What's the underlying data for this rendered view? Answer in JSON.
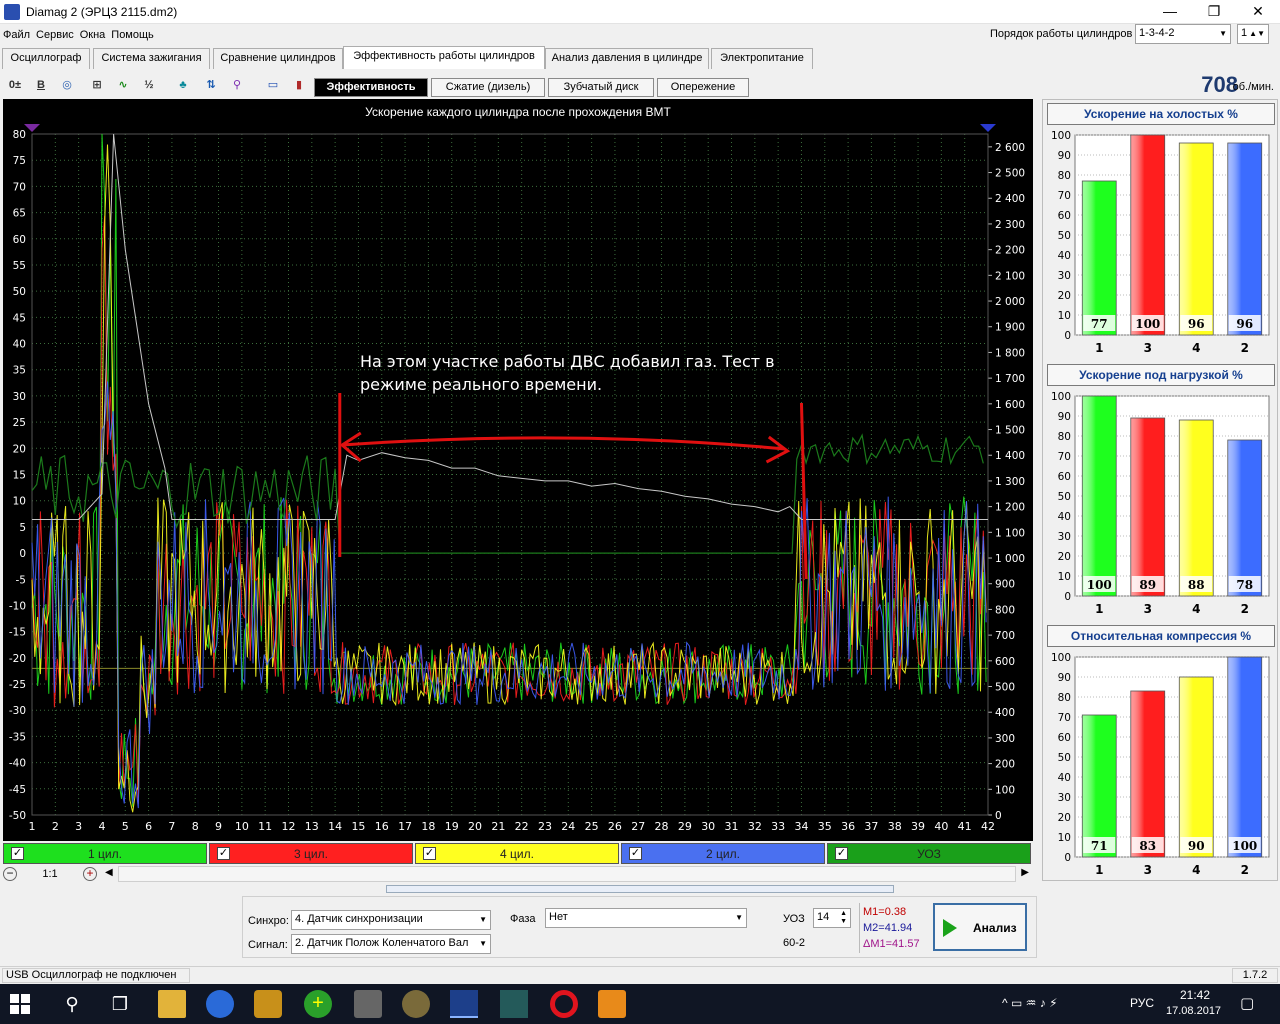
{
  "window": {
    "title": "Diamag 2 (ЭРЦЗ 2115.dm2)"
  },
  "menu": [
    "Файл",
    "Сервис",
    "Окна",
    "Помощь"
  ],
  "cylinder_order": {
    "label": "Порядок работы цилиндров",
    "value": "1-3-4-2",
    "second_value": "1"
  },
  "tabs": [
    "Осциллограф",
    "Система зажигания",
    "Сравнение цилиндров",
    "Эффективность работы цилиндров",
    "Анализ давления в цилиндре",
    "Электропитание"
  ],
  "active_tab": "Эффективность работы цилиндров",
  "toolbar": {
    "subtabs": [
      "Эффективность",
      "Сжатие (дизель)",
      "Зубчатый диск",
      "Опережение"
    ],
    "rpm": "708",
    "rpm_unit": "об./мин.",
    "b_label": "B"
  },
  "chart": {
    "title": "Ускорение каждого цилиндра после прохождения ВМТ",
    "annotation_line1": "На этом участке работы ДВС добавил газ. Тест в",
    "annotation_line2": "режиме реального времени.",
    "colors": {
      "background": "#000000",
      "grid": "#3c6e3c",
      "cyl1": "#1ee01e",
      "cyl3": "#ff2020",
      "cyl4": "#ffff20",
      "cyl2": "#4060ff",
      "uoz": "#1b7a1b",
      "rpm": "#c8c8c8",
      "annotation": "#e01010"
    }
  },
  "chart_data": {
    "type": "line",
    "title": "Ускорение каждого цилиндра после прохождения ВМТ",
    "x_ticks": [
      "1",
      "2",
      "3",
      "4",
      "5",
      "6",
      "7",
      "8",
      "9",
      "10",
      "11",
      "12",
      "13",
      "14",
      "15",
      "16",
      "17",
      "18",
      "19",
      "20",
      "21",
      "22",
      "23",
      "24",
      "25",
      "26",
      "27",
      "28",
      "29",
      "30",
      "31",
      "32",
      "33",
      "34",
      "35",
      "36",
      "37",
      "38",
      "39",
      "40",
      "41",
      "42"
    ],
    "y_left_ticks": [
      "80",
      "75",
      "70",
      "65",
      "60",
      "55",
      "50",
      "45",
      "40",
      "35",
      "30",
      "25",
      "20",
      "15",
      "10",
      "5",
      "0",
      "-5",
      "-10",
      "-15",
      "-20",
      "-25",
      "-30",
      "-35",
      "-40",
      "-45",
      "-50"
    ],
    "y_right_ticks": [
      "2 600",
      "2 500",
      "2 400",
      "2 300",
      "2 200",
      "2 100",
      "2 000",
      "1 900",
      "1 800",
      "1 700",
      "1 600",
      "1 500",
      "1 400",
      "1 300",
      "1 200",
      "1 100",
      "1 000",
      "900",
      "800",
      "700",
      "600",
      "500",
      "400",
      "300",
      "200",
      "100",
      "0"
    ],
    "ylim_left": [
      -50,
      80
    ],
    "ylim_right": [
      0,
      2650
    ],
    "xlim": [
      1,
      42
    ],
    "grid": true,
    "series": [
      {
        "name": "1 цил.",
        "color": "#1ee01e"
      },
      {
        "name": "3 цил.",
        "color": "#ff2020"
      },
      {
        "name": "4 цил.",
        "color": "#ffff20"
      },
      {
        "name": "2 цил.",
        "color": "#4060ff"
      },
      {
        "name": "УОЗ",
        "color": "#1b7a1b"
      }
    ],
    "rpm_trace": {
      "color": "#c8c8c8",
      "x": [
        1,
        3,
        4,
        4.5,
        5,
        6,
        6.7,
        7,
        13.5,
        14,
        14.5,
        15,
        16,
        17,
        18,
        19,
        20,
        21,
        22,
        23,
        24,
        25,
        26,
        27,
        28,
        29,
        30,
        31,
        32,
        33,
        33.5,
        34,
        35,
        42
      ],
      "y": [
        1150,
        1150,
        1250,
        2650,
        2200,
        1600,
        1350,
        1150,
        1150,
        1150,
        1400,
        1380,
        1410,
        1390,
        1380,
        1350,
        1350,
        1320,
        1310,
        1300,
        1300,
        1280,
        1290,
        1270,
        1260,
        1240,
        1230,
        1210,
        1200,
        1180,
        1200,
        1150,
        1150,
        1150
      ]
    }
  },
  "legend": [
    {
      "label": "1 цил.",
      "bg": "#1ee01e",
      "checked": "✓"
    },
    {
      "label": "3 цил.",
      "bg": "#ff2020",
      "checked": "✓"
    },
    {
      "label": "4 цил.",
      "bg": "#ffff20",
      "checked": "✓"
    },
    {
      "label": "2 цил.",
      "bg": "#4a70f0",
      "checked": "✓"
    },
    {
      "label": "УОЗ",
      "bg": "#1aa01a",
      "checked": "✓"
    }
  ],
  "zoom": {
    "value": "1:1"
  },
  "bar_panels": [
    {
      "title": "Ускорение на холостых %",
      "y_ticks": [
        "100",
        "90",
        "80",
        "70",
        "60",
        "50",
        "40",
        "30",
        "20",
        "10",
        "0"
      ],
      "categories": [
        "1",
        "3",
        "4",
        "2"
      ],
      "values": [
        77,
        100,
        96,
        96
      ],
      "colors": [
        "#1eff1e",
        "#ff1e1e",
        "#ffff1e",
        "#3c6cff"
      ]
    },
    {
      "title": "Ускорение под нагрузкой %",
      "y_ticks": [
        "100",
        "90",
        "80",
        "70",
        "60",
        "50",
        "40",
        "30",
        "20",
        "10",
        "0"
      ],
      "categories": [
        "1",
        "3",
        "4",
        "2"
      ],
      "values": [
        100,
        89,
        88,
        78
      ],
      "colors": [
        "#1eff1e",
        "#ff1e1e",
        "#ffff1e",
        "#3c6cff"
      ]
    },
    {
      "title": "Относительная компрессия %",
      "y_ticks": [
        "100",
        "90",
        "80",
        "70",
        "60",
        "50",
        "40",
        "30",
        "20",
        "10",
        "0"
      ],
      "categories": [
        "1",
        "3",
        "4",
        "2"
      ],
      "values": [
        71,
        83,
        90,
        100
      ],
      "colors": [
        "#1eff1e",
        "#ff1e1e",
        "#ffff1e",
        "#3c6cff"
      ]
    }
  ],
  "controls": {
    "sync_label": "Синхро:",
    "sync_value": "4. Датчик синхронизации",
    "signal_label": "Сигнал:",
    "signal_value": "2. Датчик Полож Коленчатого Вал",
    "phase_label": "Фаза",
    "phase_value": "Нет",
    "uoz_label": "УОЗ",
    "uoz_value": "14",
    "teeth": "60-2",
    "m1": "M1=0.38",
    "m2": "M2=41.94",
    "dm1": "ΔM1=41.57",
    "analyze": "Анализ"
  },
  "status": {
    "left": "USB Осциллограф не подключен",
    "version": "1.7.2"
  },
  "taskbar": {
    "lang": "РУС",
    "time": "21:42",
    "date": "17.08.2017"
  }
}
